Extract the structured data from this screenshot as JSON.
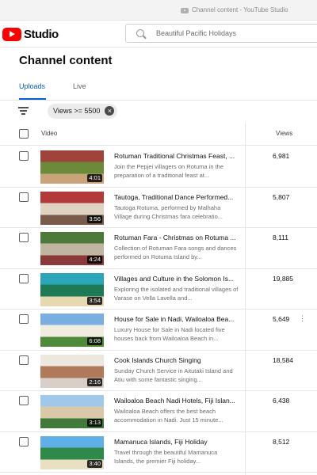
{
  "window": {
    "title": "Channel content - YouTube Studio"
  },
  "header": {
    "logo_text": "Studio",
    "search": {
      "value": "Beautiful Pacific Holidays"
    }
  },
  "page_title": "Channel content",
  "tabs": [
    {
      "label": "Uploads",
      "active": true
    },
    {
      "label": "Live",
      "active": false
    }
  ],
  "filter_chip": {
    "label": "Views >= 5500",
    "close_glyph": "×"
  },
  "table": {
    "columns": {
      "video": "Video",
      "views": "Views"
    },
    "rows": [
      {
        "title": "Rotuman Traditional Christmas Feast, ...",
        "description": "Join the Pepjei villagers on Rotuma in the preparation of a traditional feast at...",
        "duration": "4:01",
        "views": "6,981",
        "thumb_colors": [
          "#a0443a",
          "#6b8a3a",
          "#c9a47a"
        ]
      },
      {
        "title": "Tautoga, Traditional Dance Performed...",
        "description": "Tautoga Rotuma, performed by Malhaha Village during Christmas fara celebratio...",
        "duration": "3:56",
        "views": "5,807",
        "thumb_colors": [
          "#b33a3a",
          "#e0d2c0",
          "#7a5a4a"
        ]
      },
      {
        "title": "Rotuman Fara - Christmas on Rotuma ...",
        "description": "Collection of Rotuman Fara songs and dances performed on Rotuma Island by...",
        "duration": "4:24",
        "views": "8,111",
        "thumb_colors": [
          "#4d7a3a",
          "#c0b5a0",
          "#8a3a3a"
        ]
      },
      {
        "title": "Villages and Culture in the Solomon Is...",
        "description": "Exploring the isolated and traditional villages of Varase on Vella Lavella and...",
        "duration": "3:54",
        "views": "19,885",
        "thumb_colors": [
          "#2aa6b8",
          "#1d7a55",
          "#e6d9b0"
        ]
      },
      {
        "title": "House for Sale in Nadi, Wailoaloa Bea...",
        "description": "Luxury House for Sale in Nadi located five houses back from Wailoaloa Beach in...",
        "duration": "6:08",
        "views": "5,649",
        "thumb_colors": [
          "#7aaee0",
          "#f0ece0",
          "#4f8a3a"
        ]
      },
      {
        "title": "Cook Islands Church Singing",
        "description": "Sunday Church Service in Aitutaki Island and Atiu with some fantastic singing...",
        "duration": "2:16",
        "views": "18,584",
        "thumb_colors": [
          "#ece8e0",
          "#b07a5a",
          "#d8d0c8"
        ]
      },
      {
        "title": "Wailoaloa Beach Nadi Hotels, Fiji Islan...",
        "description": "Wailoaloa Beach offers the best beach accommodation in Nadi. Just 15 minute...",
        "duration": "3:13",
        "views": "6,438",
        "thumb_colors": [
          "#9ec9ea",
          "#d9c9a8",
          "#3f7a3a"
        ]
      },
      {
        "title": "Mamanuca Islands, Fiji Holiday",
        "description": "Travel through the beautiful Mamanuca Islands, the premier Fiji holiday...",
        "duration": "3:40",
        "views": "8,512",
        "thumb_colors": [
          "#5fb0e6",
          "#2f8a4a",
          "#e8e0c0"
        ]
      }
    ]
  }
}
